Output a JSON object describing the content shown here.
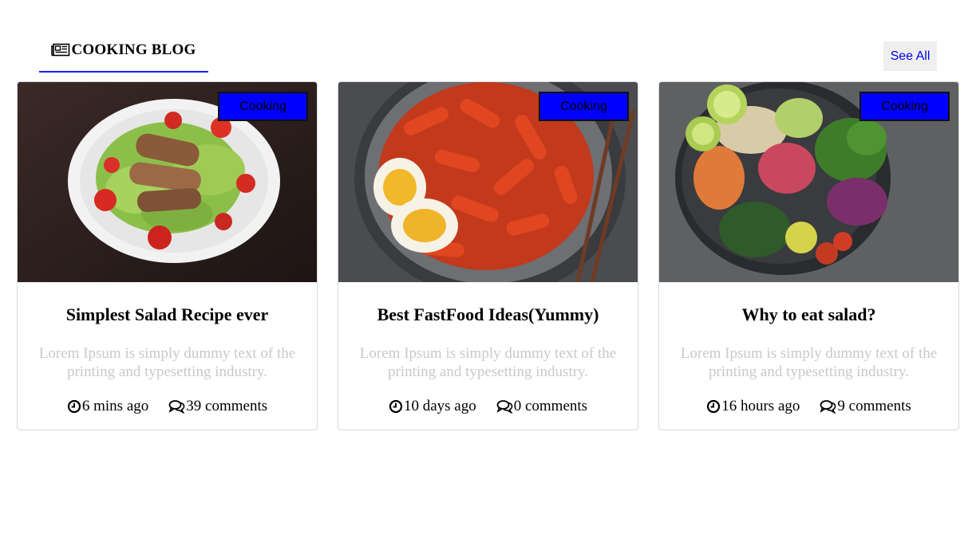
{
  "header": {
    "title": "COOKING BLOG",
    "icon": "newspaper-icon"
  },
  "see_all_label": "See All",
  "colors": {
    "accent": "#0000ff",
    "underline": "#1a1aff",
    "link": "#0000ee",
    "muted": "#c9c9c9"
  },
  "cards": [
    {
      "image": "caesar-salad-with-grilled-chicken",
      "badge": "Cooking",
      "title": "Simplest Salad Recipe ever",
      "description": "Lorem Ipsum is simply dummy text of the printing and typesetting industry.",
      "time": "6 mins ago",
      "comments": "39 comments"
    },
    {
      "image": "spicy-rice-cakes-with-eggs",
      "badge": "Cooking",
      "title": "Best FastFood Ideas(Yummy)",
      "description": "Lorem Ipsum is simply dummy text of the printing and typesetting industry.",
      "time": "10 days ago",
      "comments": "0 comments"
    },
    {
      "image": "vegetable-buddha-bowl",
      "badge": "Cooking",
      "title": "Why to eat salad?",
      "description": "Lorem Ipsum is simply dummy text of the printing and typesetting industry.",
      "time": "16 hours ago",
      "comments": "9 comments"
    }
  ]
}
